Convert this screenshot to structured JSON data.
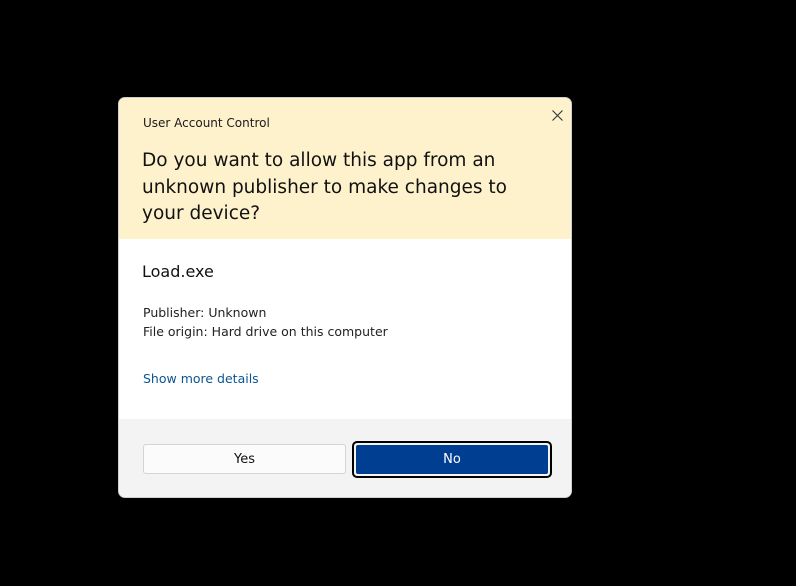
{
  "dialog": {
    "title": "User Account Control",
    "question": "Do you want to allow this app from an unknown publisher to make changes to your device?",
    "app_name": "Load.exe",
    "publisher": "Publisher: Unknown",
    "file_origin": "File origin: Hard drive on this computer",
    "details_link": "Show more details",
    "yes_label": "Yes",
    "no_label": "No"
  },
  "colors": {
    "header_background": "#fdf2cc",
    "primary_button": "#003e92",
    "link": "#0a5694",
    "backdrop": "#000000"
  },
  "icons": {
    "close": "close-icon"
  }
}
